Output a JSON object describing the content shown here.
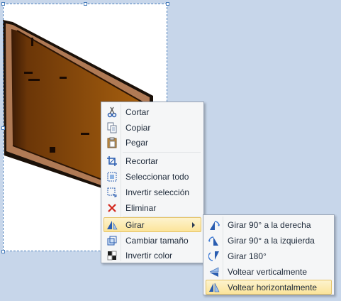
{
  "context_menu": {
    "items": [
      {
        "label": "Cortar",
        "icon": "scissors-icon"
      },
      {
        "label": "Copiar",
        "icon": "copy-icon"
      },
      {
        "label": "Pegar",
        "icon": "paste-icon"
      },
      {
        "label": "Recortar",
        "icon": "crop-icon"
      },
      {
        "label": "Seleccionar todo",
        "icon": "select-all-icon"
      },
      {
        "label": "Invertir selección",
        "icon": "invert-selection-icon"
      },
      {
        "label": "Eliminar",
        "icon": "delete-icon"
      },
      {
        "label": "Girar",
        "icon": "rotate-icon",
        "highlighted": true,
        "has_submenu": true
      },
      {
        "label": "Cambiar tamaño",
        "icon": "resize-icon"
      },
      {
        "label": "Invertir color",
        "icon": "invert-color-icon"
      }
    ]
  },
  "rotate_submenu": {
    "items": [
      {
        "label": "Girar 90° a la derecha",
        "icon": "rotate-right-90-icon"
      },
      {
        "label": "Girar 90° a la izquierda",
        "icon": "rotate-left-90-icon"
      },
      {
        "label": "Girar 180°",
        "icon": "rotate-180-icon"
      },
      {
        "label": "Voltear verticalmente",
        "icon": "flip-vertical-icon"
      },
      {
        "label": "Voltear horizontalmente",
        "icon": "flip-horizontal-icon",
        "highlighted": true
      }
    ]
  },
  "colors": {
    "workspace": "#c7d6ea",
    "selection": "#4a7ebb",
    "highlight": "#fbe49a",
    "door_wood": "#8b4a14",
    "door_frame": "#a0643a"
  }
}
